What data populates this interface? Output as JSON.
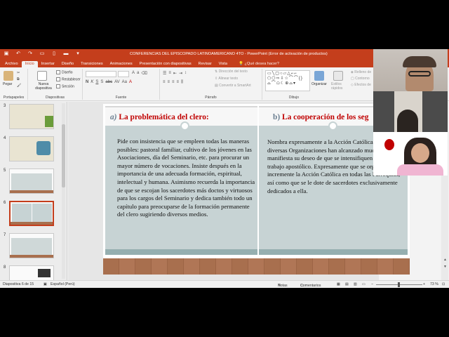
{
  "app": {
    "title": "CONFERENCIAS DEL  EPISCOPADO LATINOAMERICANO 4TO - PowerPoint (Error de activación de productos)",
    "accent": "#c43e1c"
  },
  "tabs": [
    "Archivo",
    "Inicio",
    "Insertar",
    "Diseño",
    "Transiciones",
    "Animaciones",
    "Presentación con diapositivas",
    "Revisar",
    "Vista"
  ],
  "tell_me": "¿Qué desea hacer?",
  "ribbon": {
    "paste": "Pegar",
    "new_slide": "Nueva diapositiva",
    "design": "Diseño",
    "reset": "Restablecer",
    "section": "Sección",
    "text_direction": "Dirección del texto",
    "align_text": "Alinear texto",
    "smartart": "Convertir a SmartArt",
    "organize": "Organizar",
    "quick_styles": "Estilos rápidos",
    "fill": "Relleno de",
    "outline": "Contorno",
    "effects": "Efectos de",
    "groups": {
      "clipboard": "Portapapeles",
      "slides": "Diapositivas",
      "font": "Fuente",
      "paragraph": "Párrafo",
      "drawing": "Dibujo"
    }
  },
  "thumbnails": [
    {
      "num": "3",
      "selected": false
    },
    {
      "num": "4",
      "selected": false
    },
    {
      "num": "5",
      "selected": false
    },
    {
      "num": "6",
      "selected": true
    },
    {
      "num": "7",
      "selected": false
    },
    {
      "num": "8",
      "selected": false
    }
  ],
  "slide": {
    "left": {
      "prefix": "a)",
      "heading": "La problemática del clero:",
      "body": "Pide con insistencia que se empleen todas las maneras posibles: pastoral familiar, cultivo de los jóvenes en las Asociaciones, día del Seminario, etc. para procurar un mayor número de vocaciones. Insiste después en la importancia de una adecuada formación, espiritual, intelectual y humana. Asimismo recuerda la importancia de que se escojan los sacerdotes más doctos y virtuosos para los cargos del Seminario y dedica también todo un capítulo para preocuparse de la formación permanente del clero sugiriendo diversos medios."
    },
    "right": {
      "prefix": "b)",
      "heading": "La cooperación de los seg",
      "body": "Nombra expresamente a la Acción Católica bajo diversas Organizaciones han alcanzado muchos frutos y manifiesta su deseo de que se intensifiquen cada vez su trabajo apostólico. Expresamente que se organice e incremente la Acción Católica en todas las Parroquias, así como que se le dote de sacerdotes exclusivamente dedicados a ella."
    }
  },
  "status": {
    "slide_of": "Diapositiva 6 de 15",
    "language": "Español (Perú)",
    "notes": "Notas",
    "comments": "Comentarios",
    "zoom": "73 %"
  }
}
